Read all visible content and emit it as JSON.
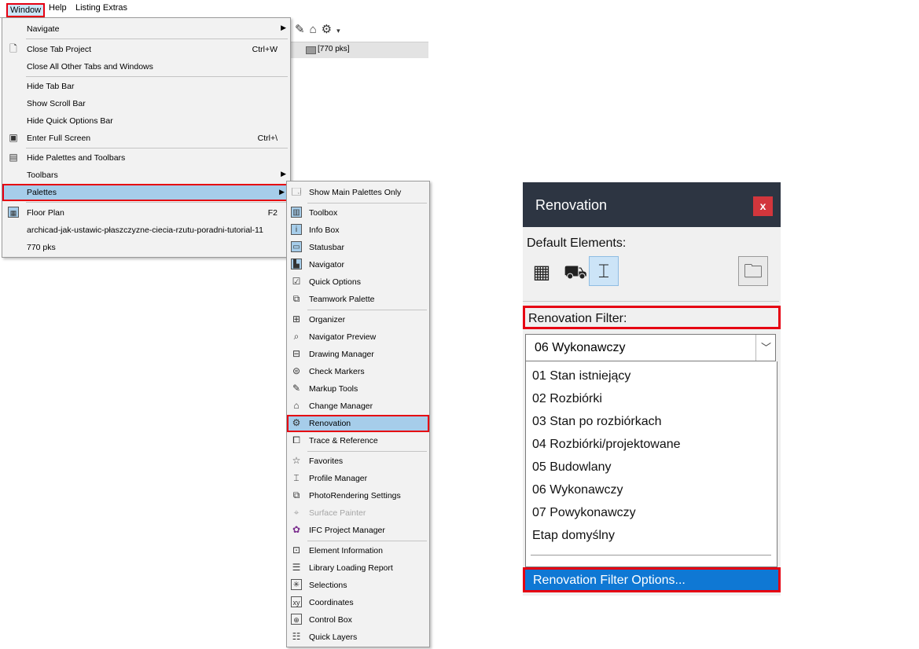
{
  "menubar": {
    "items": [
      "Window",
      "Help",
      "Listing Extras"
    ]
  },
  "toolbar": {
    "icons": [
      "markup-pen-icon",
      "change-manager-icon",
      "renovation-icon",
      "dropdown-arrow-icon"
    ]
  },
  "tab": {
    "label": "[770 pks]"
  },
  "window_menu": {
    "navigate": "Navigate",
    "close_tab": "Close Tab Project",
    "close_tab_shortcut": "Ctrl+W",
    "close_all": "Close All Other Tabs and Windows",
    "hide_tab_bar": "Hide Tab Bar",
    "show_scroll_bar": "Show Scroll Bar",
    "hide_quick_options": "Hide Quick Options Bar",
    "enter_full_screen": "Enter Full Screen",
    "full_screen_shortcut": "Ctrl+\\",
    "hide_palettes": "Hide Palettes and Toolbars",
    "toolbars": "Toolbars",
    "palettes": "Palettes",
    "floor_plan": "Floor Plan",
    "floor_plan_shortcut": "F2",
    "tutorial": "archicad-jak-ustawic-płaszczyzne-ciecia-rzutu-poradni-tutorial-11",
    "pks": "770 pks"
  },
  "palettes_menu": {
    "items": [
      "Show Main Palettes Only",
      "Toolbox",
      "Info Box",
      "Statusbar",
      "Navigator",
      "Quick Options",
      "Teamwork Palette",
      "Organizer",
      "Navigator Preview",
      "Drawing Manager",
      "Check Markers",
      "Markup Tools",
      "Change Manager",
      "Renovation",
      "Trace & Reference",
      "Favorites",
      "Profile Manager",
      "PhotoRendering Settings",
      "Surface Painter",
      "IFC Project Manager",
      "Element Information",
      "Library Loading Report",
      "Selections",
      "Coordinates",
      "Control Box",
      "Quick Layers"
    ]
  },
  "renovation_palette": {
    "title": "Renovation",
    "close": "x",
    "default_elements": "Default Elements:",
    "filter_label": "Renovation Filter:",
    "selected": "06 Wykonawczy",
    "options": [
      "01 Stan istniejący",
      "02 Rozbiórki",
      "03 Stan po rozbiórkach",
      "04 Rozbiórki/projektowane",
      "05 Budowlany",
      "06 Wykonawczy",
      "07 Powykonawczy",
      "Etap domyślny"
    ],
    "filter_options": "Renovation Filter Options..."
  },
  "colors": {
    "highlight": "#a6cdea",
    "annotation_red": "#e60012",
    "palette_header": "#2d3542",
    "selection_blue": "#0f78d4"
  }
}
